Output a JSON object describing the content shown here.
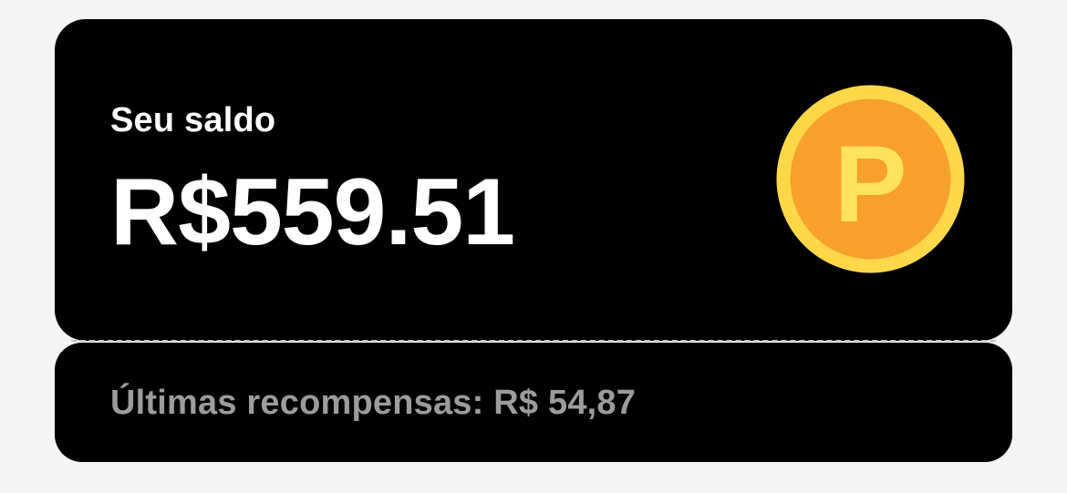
{
  "balance": {
    "label": "Seu saldo",
    "amount": "R$559.51",
    "coin_icon": "points-coin-icon",
    "coin_letter": "P"
  },
  "rewards": {
    "text": "Últimas recompensas: R$ 54,87"
  },
  "colors": {
    "card_background": "#000000",
    "page_background": "#f4f4f4",
    "primary_text": "#ffffff",
    "secondary_text": "#9c9c9c",
    "coin_outer": "#ffd84a",
    "coin_inner": "#f7a02a",
    "coin_letter": "#ffe35c"
  }
}
